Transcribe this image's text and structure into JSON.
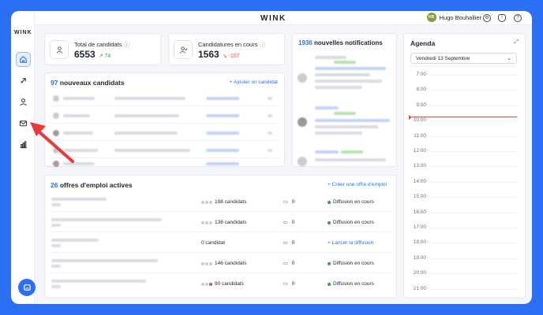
{
  "app": {
    "brand": "WINK"
  },
  "header": {
    "user_initials": "HB",
    "user_name": "Hugo Bouhallier",
    "icons": [
      "gear-icon",
      "bell-icon",
      "help-icon"
    ]
  },
  "sidebar": {
    "items": [
      "home-icon",
      "rocket-icon",
      "user-icon",
      "mail-icon",
      "chart-icon"
    ],
    "chat": "chat-icon"
  },
  "stats": [
    {
      "title": "Total de candidats",
      "value": "6553",
      "delta": "74",
      "trend": "up"
    },
    {
      "title": "Candidatures en cours",
      "value": "1563",
      "delta": "-107",
      "trend": "down"
    }
  ],
  "new_candidates": {
    "count": "97",
    "label": "nouveaux candidats",
    "action": "+ Ajouter un candidat"
  },
  "notifications": {
    "count": "1936",
    "label": "nouvelles notifications"
  },
  "jobs": {
    "count": "26",
    "label": "offres d'emploi actives",
    "action": "+ Créer une offre d'emploi",
    "rows": [
      {
        "candidates": "198 candidats",
        "messages": "0",
        "status": "Diffusion en cours",
        "live": true
      },
      {
        "candidates": "138 candidats",
        "messages": "0",
        "status": "Diffusion en cours",
        "live": true
      },
      {
        "candidates": "0 candidat",
        "messages": "0",
        "status": "+ Lancer la diffusion",
        "live": false
      },
      {
        "candidates": "146 candidats",
        "messages": "0",
        "status": "Diffusion en cours",
        "live": true
      },
      {
        "candidates": "90 candidats",
        "messages": "0",
        "status": "Diffusion en cours",
        "live": true
      }
    ]
  },
  "agenda": {
    "title": "Agenda",
    "date": "Vendredi 13 Septembre",
    "hours": [
      "7:00",
      "8:00",
      "9:00",
      "10:00",
      "11:00",
      "12:00",
      "13:00",
      "14:00",
      "15:00",
      "16:00",
      "17:00",
      "18:00",
      "19:00",
      "20:00",
      "21:00"
    ]
  },
  "colors": {
    "accent": "#2b6ff5",
    "up": "#27a745",
    "down": "#e84a4a"
  }
}
